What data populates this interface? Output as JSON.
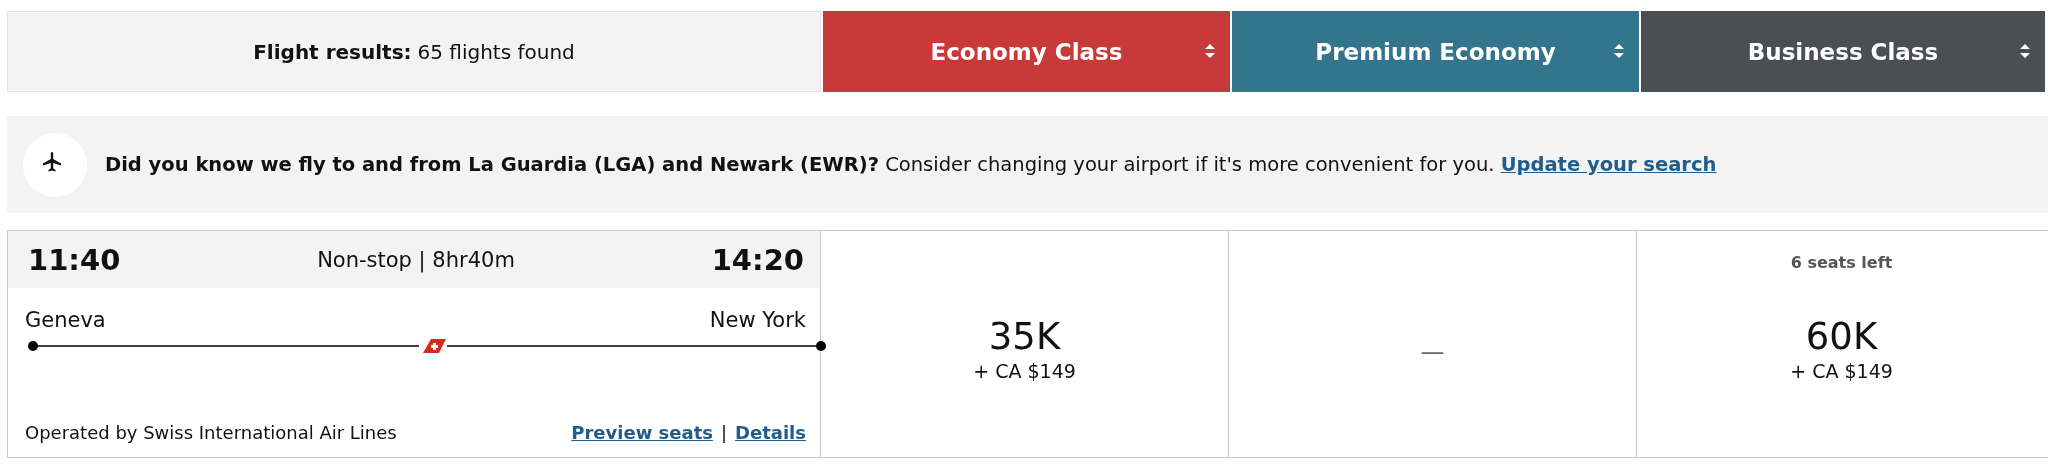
{
  "results_header": {
    "label": "Flight results:",
    "count": "65 flights found"
  },
  "cabins": [
    {
      "label": "Economy Class",
      "color": "#c83a39"
    },
    {
      "label": "Premium Economy",
      "color": "#33758c"
    },
    {
      "label": "Business Class",
      "color": "#4b4e52"
    }
  ],
  "notice": {
    "text": "**Did you know we fly to and from La Guardia (LGA) and Newark (EWR)?** Consider changing your airport if it's more convenient for you.",
    "link": "Update your search"
  },
  "flights": [
    {
      "depart_time": "11:40",
      "summary": "Non-stop | 8hr40m",
      "arrive_time": "14:20",
      "origin": "Geneva",
      "destination": "New York",
      "operator": "Operated by Swiss International Air Lines",
      "links": [
        "Preview seats",
        "Details"
      ],
      "link_separator": "|",
      "fares": [
        {
          "kind": "price",
          "points": "35K",
          "cash": "+ CA $149"
        },
        {
          "kind": "unavailable",
          "text": "—"
        },
        {
          "kind": "price",
          "note": "6 seats left",
          "points": "60K",
          "cash": "+ CA $149"
        }
      ]
    }
  ]
}
